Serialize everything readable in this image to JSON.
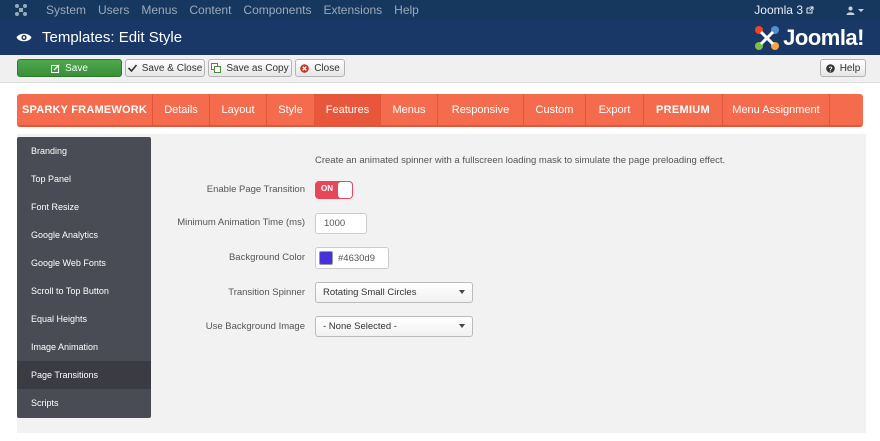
{
  "navbar": {
    "logo_icon": "joomla-icon",
    "menu": [
      "System",
      "Users",
      "Menus",
      "Content",
      "Components",
      "Extensions",
      "Help"
    ],
    "site_link": "Joomla 3",
    "user_icon": "user-icon"
  },
  "header": {
    "title": "Templates: Edit Style",
    "brand": "Joomla!"
  },
  "toolbar": {
    "save": "Save",
    "save_close": "Save & Close",
    "save_copy": "Save as Copy",
    "close": "Close",
    "help": "Help"
  },
  "tabs": [
    "SPARKY FRAMEWORK",
    "Details",
    "Layout",
    "Style",
    "Features",
    "Menus",
    "Responsive",
    "Custom",
    "Export",
    "PREMIUM",
    "Menu Assignment"
  ],
  "active_tab": "Features",
  "sidebar": {
    "items": [
      "Branding",
      "Top Panel",
      "Font Resize",
      "Google Analytics",
      "Google Web Fonts",
      "Scroll to Top Button",
      "Equal Heights",
      "Image Animation",
      "Page Transitions",
      "Scripts"
    ],
    "active": "Page Transitions"
  },
  "form": {
    "description": "Create an animated spinner with a fullscreen loading mask to simulate the page preloading effect.",
    "enable_label": "Enable Page Transition",
    "enable_value": "ON",
    "min_time_label": "Minimum Animation Time (ms)",
    "min_time_value": "1000",
    "bg_color_label": "Background Color",
    "bg_color_value": "#4630d9",
    "spinner_label": "Transition Spinner",
    "spinner_value": "Rotating Small Circles",
    "bg_image_label": "Use Background Image",
    "bg_image_value": "- None Selected -"
  },
  "colors": {
    "navbar": "#17385e",
    "header": "#1a3867",
    "accent": "#f56b4d",
    "toggle_on": "#e6475b",
    "swatch": "#4630d9"
  }
}
